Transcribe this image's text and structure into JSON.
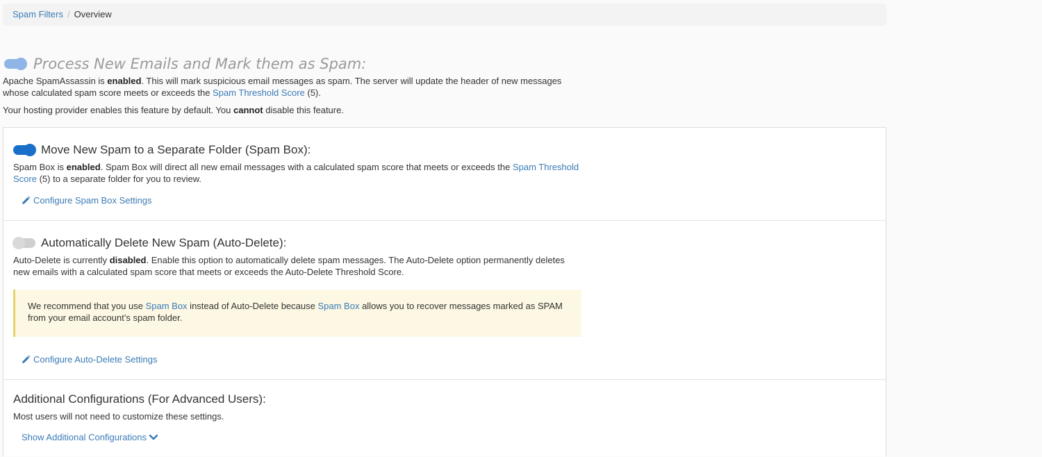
{
  "breadcrumb": {
    "parent": "Spam Filters",
    "separator": "/",
    "current": "Overview"
  },
  "process": {
    "title": "Process New Emails and Mark them as Spam:",
    "toggle_state": "on",
    "desc_pre": "Apache SpamAssassin is ",
    "desc_bold": "enabled",
    "desc_mid": ". This will mark suspicious email messages as spam. The server will update the header of new messages whose calculated spam score meets or exceeds the ",
    "desc_link": "Spam Threshold Score",
    "desc_post": " (5).",
    "note_pre": "Your hosting provider enables this feature by default. You ",
    "note_bold": "cannot",
    "note_post": " disable this feature."
  },
  "spam_box": {
    "title": "Move New Spam to a Separate Folder (Spam Box):",
    "toggle_state": "on",
    "desc_pre": "Spam Box is ",
    "desc_bold": "enabled",
    "desc_mid": ". Spam Box will direct all new email messages with a calculated spam score that meets or exceeds the ",
    "desc_link": "Spam Threshold Score",
    "desc_post": " (5) to a separate folder for you to review.",
    "action_label": "Configure Spam Box Settings"
  },
  "auto_delete": {
    "title": "Automatically Delete New Spam (Auto-Delete):",
    "toggle_state": "off",
    "desc_pre": "Auto-Delete is currently ",
    "desc_bold": "disabled",
    "desc_post": ". Enable this option to automatically delete spam messages. The Auto-Delete option permanently deletes new emails with a calculated spam score that meets or exceeds the Auto-Delete Threshold Score.",
    "alert_pre": "We recommend that you use ",
    "alert_link1": "Spam Box",
    "alert_mid": " instead of Auto-Delete because ",
    "alert_link2": "Spam Box",
    "alert_post": " allows you to recover messages marked as SPAM from your email account’s spam folder.",
    "action_label": "Configure Auto-Delete Settings"
  },
  "additional": {
    "title": "Additional Configurations (For Advanced Users):",
    "desc": "Most users will not need to customize these settings.",
    "action_label": "Show Additional Configurations"
  },
  "colors": {
    "link": "#3a7bb6",
    "toggle_on": "#1a6fc9",
    "toggle_off": "#cfcfcf",
    "alert_bg": "#fcf8e3"
  }
}
